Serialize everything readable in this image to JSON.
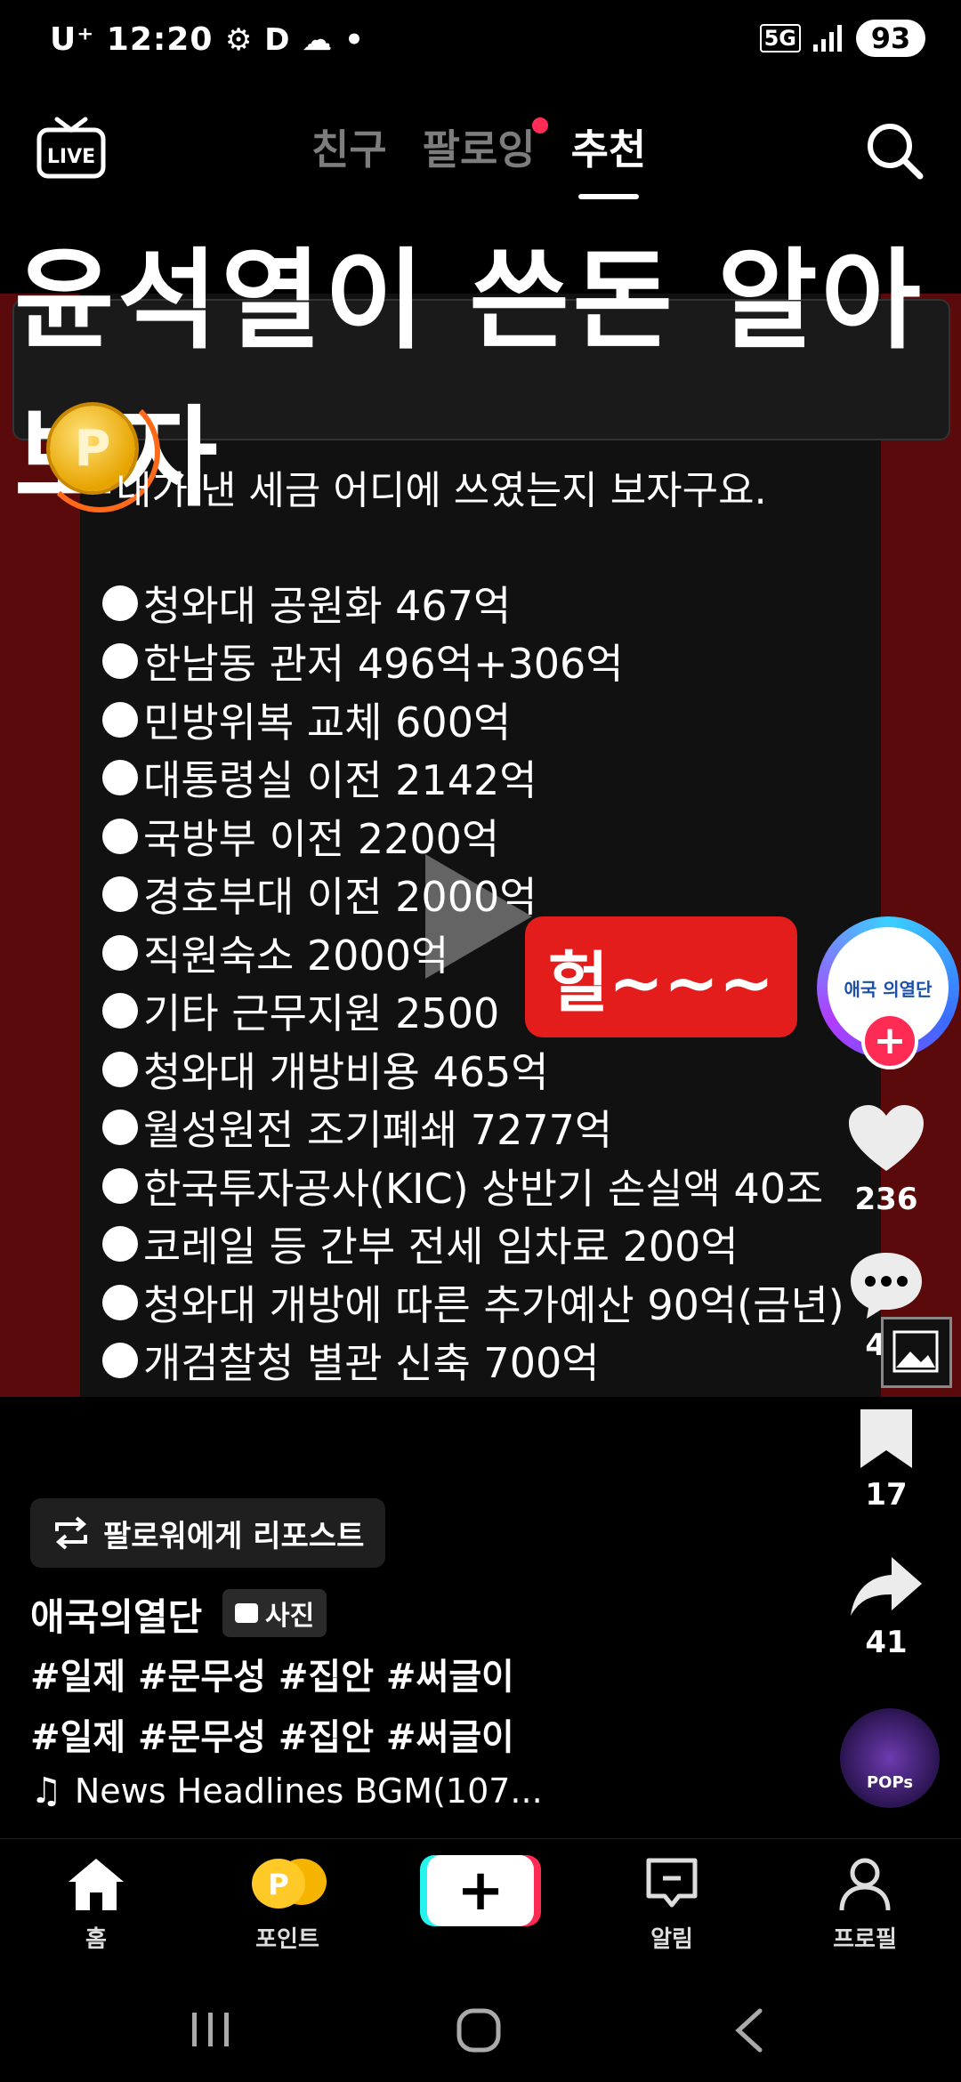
{
  "status": {
    "carrier": "U⁺",
    "time": "12:20",
    "network": "5G",
    "battery": "93"
  },
  "nav": {
    "live_label": "LIVE",
    "tabs": [
      "친구",
      "팔로잉",
      "추천"
    ]
  },
  "post": {
    "banner": "윤석열이 쓴돈 알아보자",
    "intro": "내가 낸 세금 어디에 쓰였는지 보자구요.",
    "items": [
      "청와대 공원화 467억",
      "한남동 관저 496억+306억",
      "민방위복 교체 600억",
      "대통령실 이전 2142억",
      "국방부 이전 2200억",
      "경호부대 이전 2000억",
      "직원숙소 2000억",
      "기타 근무지원 2500",
      "청와대 개방비용 465억",
      "월성원전 조기폐쇄  7277억",
      "한국투자공사(KIC) 상반기  손실액 40조",
      "코레일 등 간부 전세 임차료 200억",
      "청와대 개방에 따른 추가예산 90억(금년)",
      "개검찰청 별관 신축 700억"
    ],
    "sticker": "헐~~~",
    "avatar_text": "애국 의열단"
  },
  "rail": {
    "likes": "236",
    "comments": "40",
    "saves": "17",
    "shares": "41",
    "disc_label": "POPs"
  },
  "info": {
    "repost_label": "팔로워에게 리포스트",
    "author": "애국의열단",
    "badge": "사진",
    "hashtags1": "#일제 #문무성  #집안 #써글이",
    "hashtags2": "#일제 #문무성  #집안 #써글이",
    "music": "News Headlines BGM(107..."
  },
  "bottom_nav": {
    "home": "홈",
    "points": "포인트",
    "create": "+",
    "inbox": "알림",
    "profile": "프로필"
  }
}
